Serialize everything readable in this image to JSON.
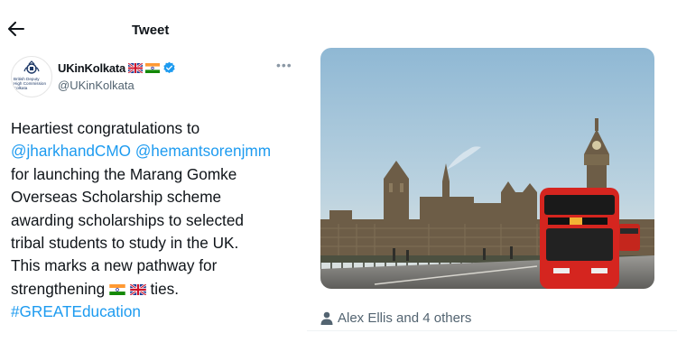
{
  "header": {
    "title": "Tweet",
    "back_icon": "back-arrow-icon"
  },
  "author": {
    "display_name": "UKinKolkata",
    "handle": "@UKinKolkata",
    "avatar_text": "British Deputy\nHigh Commission\nKolkata",
    "name_flags": [
      "uk-flag-icon",
      "india-flag-icon"
    ],
    "verified_icon": "verified-badge-icon",
    "more_icon": "more-options-icon"
  },
  "tweet": {
    "line1": "Heartiest congratulations to",
    "mention1": "@jharkhandCMO",
    "mention2": "@hemantsorenjmm",
    "line3": "for launching the Marang Gomke",
    "line4": "Overseas Scholarship scheme",
    "line5": "awarding scholarships to selected",
    "line6": "tribal students to study in the UK.",
    "line7": "This marks a new pathway for",
    "line8_start": "strengthening",
    "line8_end": "ties.",
    "hashtag": "#GREATEducation",
    "inline_flags": [
      "india-flag-icon",
      "uk-flag-icon"
    ]
  },
  "media": {
    "description_icon": "london-westminster-photo"
  },
  "likes": {
    "text": "Alex Ellis and 4 others",
    "icon": "person-icon"
  },
  "colors": {
    "link": "#1d9bf0",
    "secondary": "#536471",
    "verified": "#1d9bf0",
    "text": "#0f1419"
  }
}
